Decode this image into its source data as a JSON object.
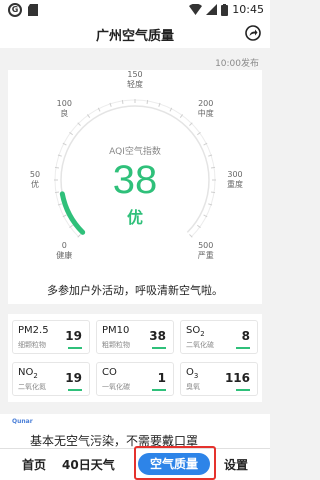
{
  "status": {
    "time": "10:45"
  },
  "header": {
    "title": "广州空气质量",
    "share_icon": "share-icon"
  },
  "publish_time": "10:00发布",
  "aqi": {
    "label": "AQI空气指数",
    "value": 38,
    "level": "优",
    "scale_max": 500,
    "color": "#2fc07a",
    "ticks": [
      {
        "value": "0",
        "label": "健康"
      },
      {
        "value": "50",
        "label": "优"
      },
      {
        "value": "100",
        "label": "良"
      },
      {
        "value": "150",
        "label": "轻度"
      },
      {
        "value": "200",
        "label": "中度"
      },
      {
        "value": "300",
        "label": "重度"
      },
      {
        "value": "500",
        "label": "严重"
      }
    ]
  },
  "advice": "多参加户外活动，呼吸清新空气啦。",
  "pollutants": [
    {
      "name": "PM2.5",
      "sub": "",
      "desc": "细颗粒物",
      "value": "19"
    },
    {
      "name": "PM10",
      "sub": "",
      "desc": "粗颗粒物",
      "value": "38"
    },
    {
      "name": "SO",
      "sub": "2",
      "desc": "二氧化硫",
      "value": "8"
    },
    {
      "name": "NO",
      "sub": "2",
      "desc": "二氧化氮",
      "value": "19"
    },
    {
      "name": "CO",
      "sub": "",
      "desc": "一氧化碳",
      "value": "1"
    },
    {
      "name": "O",
      "sub": "3",
      "desc": "臭氧",
      "value": "116"
    }
  ],
  "news": {
    "logo": "Qunar",
    "text": "基本无空气污染，不需要戴口罩"
  },
  "tabs": {
    "home": "首页",
    "forecast": "40日天气",
    "air": "空气质量",
    "settings": "设置"
  }
}
